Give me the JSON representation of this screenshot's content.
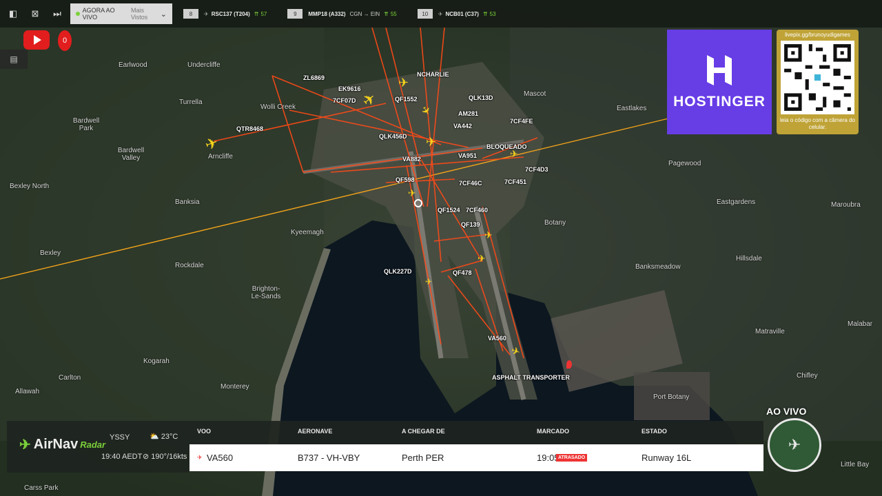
{
  "topbar": {
    "live_label": "AGORA AO VIVO",
    "view_label": "Mais Vistos",
    "flights": [
      {
        "num": "8",
        "code": "RSC137 (T204)",
        "score": "57"
      },
      {
        "num": "9",
        "code": "MMP18 (A332)",
        "route": "CGN → EIN",
        "score": "55"
      },
      {
        "num": "10",
        "code": "NCB01 (C37)",
        "score": "53"
      }
    ]
  },
  "youtube": {
    "count": "0"
  },
  "places": [
    {
      "name": "Earlwood"
    },
    {
      "name": "Undercliffe"
    },
    {
      "name": "Turrella"
    },
    {
      "name": "Wolli Creek"
    },
    {
      "name": "Bardwell Park"
    },
    {
      "name": "Bardwell Valley"
    },
    {
      "name": "Arncliffe"
    },
    {
      "name": "Bexley North"
    },
    {
      "name": "Banksia"
    },
    {
      "name": "Bexley"
    },
    {
      "name": "Kyeemagh"
    },
    {
      "name": "Rockdale"
    },
    {
      "name": "Brighton-Le-Sands"
    },
    {
      "name": "Kogarah"
    },
    {
      "name": "Carlton"
    },
    {
      "name": "Allawah"
    },
    {
      "name": "Monterey"
    },
    {
      "name": "Carss Park"
    },
    {
      "name": "Mascot"
    },
    {
      "name": "Eastlakes"
    },
    {
      "name": "Pagewood"
    },
    {
      "name": "Eastgardens"
    },
    {
      "name": "Maroubra"
    },
    {
      "name": "Botany"
    },
    {
      "name": "Banksmeadow"
    },
    {
      "name": "Hillsdale"
    },
    {
      "name": "Matraville"
    },
    {
      "name": "Port Botany"
    },
    {
      "name": "Chifley"
    },
    {
      "name": "Malabar"
    },
    {
      "name": "Little Bay"
    }
  ],
  "aircraft": [
    {
      "callsign": "ZL6869"
    },
    {
      "callsign": "NCHARLIE"
    },
    {
      "callsign": "EK9616"
    },
    {
      "callsign": "7CF07D"
    },
    {
      "callsign": "QF1552"
    },
    {
      "callsign": "QLK13D"
    },
    {
      "callsign": "AM281"
    },
    {
      "callsign": "QTR8468"
    },
    {
      "callsign": "VA442"
    },
    {
      "callsign": "7CF4FE"
    },
    {
      "callsign": "QLK456D"
    },
    {
      "callsign": "BLOQUEADO"
    },
    {
      "callsign": "VA951"
    },
    {
      "callsign": "VA882"
    },
    {
      "callsign": "7CF4D3"
    },
    {
      "callsign": "QF598"
    },
    {
      "callsign": "7CF46C"
    },
    {
      "callsign": "7CF451"
    },
    {
      "callsign": "QF1524"
    },
    {
      "callsign": "7CF460"
    },
    {
      "callsign": "QF139"
    },
    {
      "callsign": "QLK227D"
    },
    {
      "callsign": "QF478"
    },
    {
      "callsign": "VA560"
    },
    {
      "callsign": "ASPHALT TRANSPORTER"
    }
  ],
  "sponsor": {
    "name": "HOSTINGER",
    "url": "livepix.gg/brunoyudigames",
    "caption": "leia o código com a câmera do celular."
  },
  "live": {
    "label": "AO VIVO"
  },
  "station": {
    "logo": "AirNav",
    "logo_suffix": "Radar",
    "airport": "YSSY",
    "time": "19:40 AEDT",
    "temp": "23°C",
    "wind": "190°/16kts"
  },
  "table": {
    "headers": {
      "flight": "VOO",
      "aircraft": "AERONAVE",
      "from": "A CHEGAR DE",
      "scheduled": "MARCADO",
      "status": "ESTADO"
    },
    "row": {
      "flight": "VA560",
      "aircraft": "B737 - VH-VBY",
      "from": "Perth PER",
      "scheduled": "19:05",
      "delay": "ATRASADO",
      "status": "Runway 16L"
    }
  }
}
